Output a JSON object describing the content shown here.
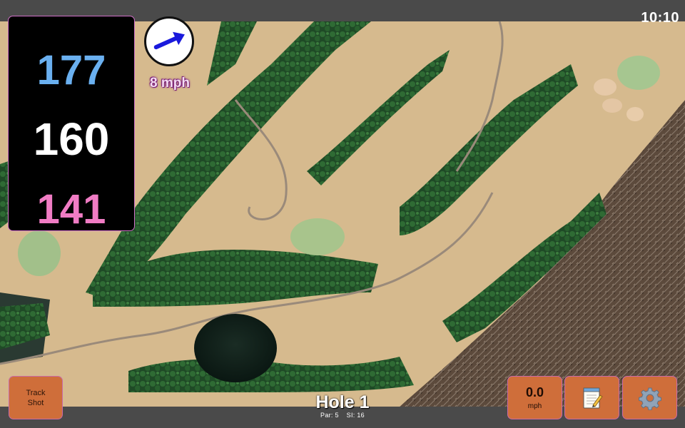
{
  "status_bar": {
    "time": "10:10"
  },
  "distances": {
    "back": "177",
    "middle": "160",
    "front": "141"
  },
  "wind": {
    "speed_label": "8 mph",
    "arrow_icon": "wind-arrow-icon"
  },
  "buttons": {
    "track_shot_line1": "Track",
    "track_shot_line2": "Shot",
    "speed_value": "0.0",
    "speed_unit": "mph",
    "notes_icon": "notepad-icon",
    "settings_icon": "gear-icon"
  },
  "hole": {
    "title": "Hole 1",
    "par": "Par: 5",
    "si": "SI: 16"
  },
  "colors": {
    "back_distance": "#6ab0f0",
    "middle_distance": "#ffffff",
    "front_distance": "#f07cc4",
    "button_bg": "#cf6e3a",
    "wind_arrow": "#1a1adc"
  }
}
